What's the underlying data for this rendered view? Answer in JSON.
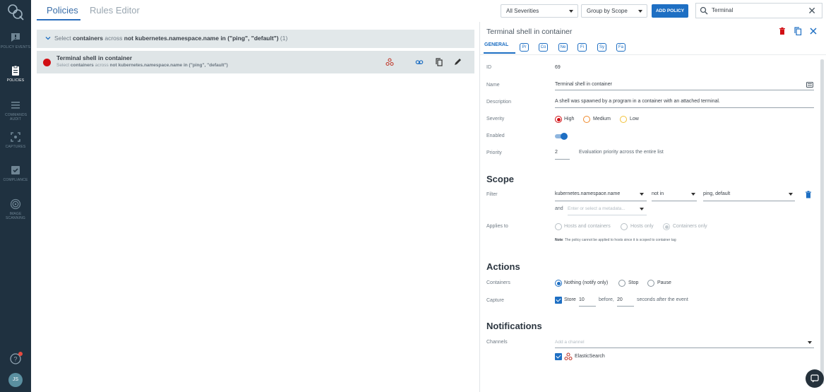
{
  "nav": {
    "items": [
      {
        "label": "POLICY EVENTS",
        "icon": "policy-events-icon"
      },
      {
        "label": "POLICIES",
        "icon": "policies-icon"
      },
      {
        "label": "COMMANDS AUDIT",
        "icon": "commands-audit-icon"
      },
      {
        "label": "CAPTURES",
        "icon": "captures-icon"
      },
      {
        "label": "COMPLIANCE",
        "icon": "compliance-icon"
      },
      {
        "label": "IMAGE SCANNING",
        "icon": "image-scanning-icon"
      }
    ],
    "avatar": "JS",
    "colors": {
      "background": "#1f3140",
      "inactive": "#6f8594",
      "active": "#ffffff"
    }
  },
  "tabs": {
    "policies": "Policies",
    "rules_editor": "Rules Editor"
  },
  "toolbar": {
    "severity": "All Severities",
    "group_by": "Group by Scope",
    "add_policy": "ADD POLICY",
    "search_value": "Terminal",
    "accent": "#1e6fc3"
  },
  "list": {
    "group": {
      "prefix": "Select",
      "containers": "containers",
      "across": "across",
      "condition": "not kubernetes.namespace.name in (\"ping\", \"default\")",
      "count": "(1)"
    },
    "policy": {
      "name": "Terminal shell in container",
      "scope_select": "Select",
      "scope_containers": "containers",
      "scope_across": "across",
      "scope_condition": "not kubernetes.namespace.name in (\"ping\", \"default\")",
      "severity_color": "#d10f14"
    }
  },
  "panel": {
    "title": "Terminal shell in container",
    "tabs": {
      "general": "GENERAL",
      "chips": [
        "Pr",
        "Co",
        "Ne",
        "Fi",
        "Sy",
        "Fa"
      ]
    },
    "id_label": "ID",
    "id_value": "69",
    "name_label": "Name",
    "name_value": "Terminal shell in container",
    "desc_label": "Description",
    "desc_value": "A shell was spawned by a program in a container with an attached terminal.",
    "severity_label": "Severity",
    "sev_high": "High",
    "sev_medium": "Medium",
    "sev_low": "Low",
    "enabled_label": "Enabled",
    "priority_label": "Priority",
    "priority_value": "2",
    "priority_hint": "Evaluation priority across the entire list",
    "scope": {
      "heading": "Scope",
      "filter_label": "Filter",
      "key": "kubernetes.namespace.name",
      "op": "not in",
      "values": "ping, default",
      "and": "and",
      "and_placeholder": "Enter or select a metadata...",
      "applies_label": "Applies to",
      "opt_hosts_containers": "Hosts and containers",
      "opt_hosts_only": "Hosts only",
      "opt_containers_only": "Containers only",
      "note_bold": "Note",
      "note_text": ": The policy cannot be applied to hosts since it is scoped to container tag"
    },
    "actions": {
      "heading": "Actions",
      "containers_label": "Containers",
      "opt_nothing": "Nothing (notify only)",
      "opt_stop": "Stop",
      "opt_pause": "Pause",
      "capture_label": "Capture",
      "store": "Store",
      "before_value": "10",
      "before_text": "before,",
      "after_value": "20",
      "after_text": "seconds after the event"
    },
    "notifications": {
      "heading": "Notifications",
      "channels_label": "Channels",
      "placeholder": "Add a channel",
      "channel": "ElasticSearch"
    }
  }
}
